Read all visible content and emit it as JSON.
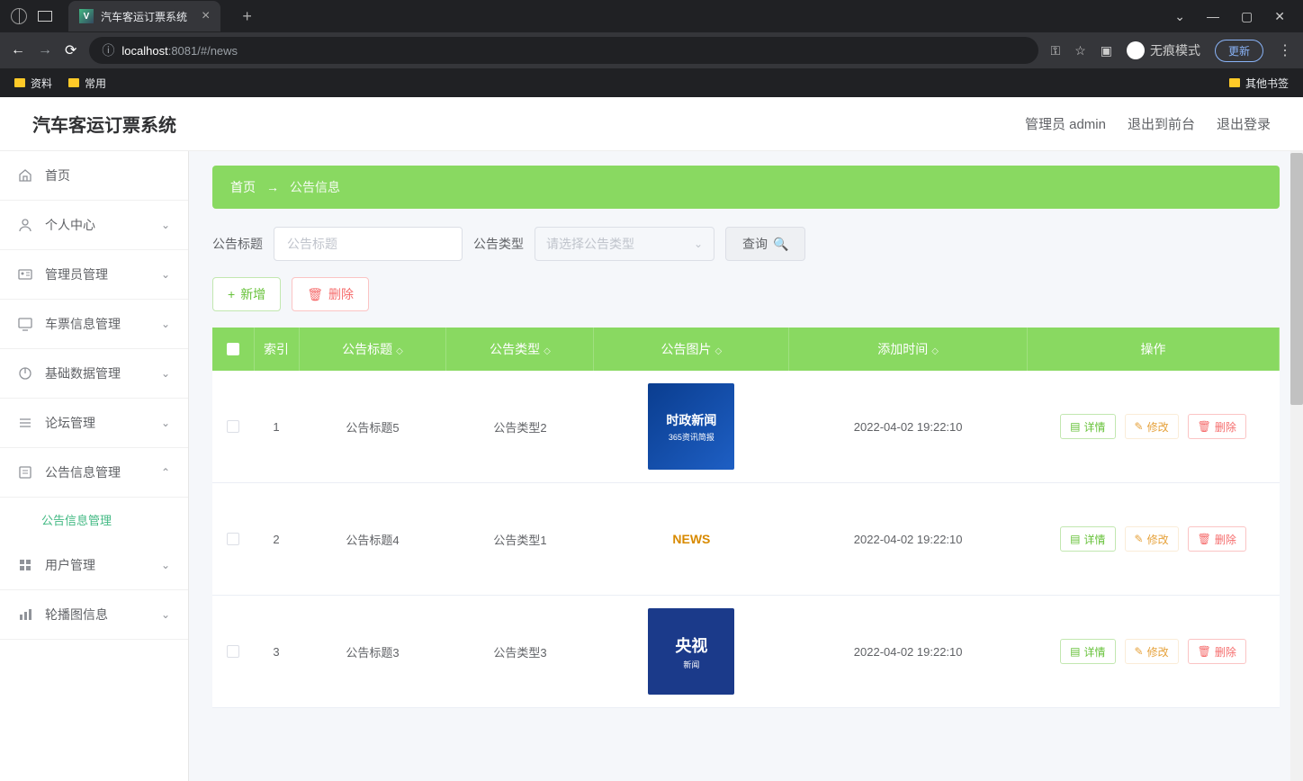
{
  "browser": {
    "tab_title": "汽车客运订票系统",
    "url_info_icon": "ⓘ",
    "url_host": "localhost",
    "url_rest": ":8081/#/news",
    "incognito_label": "无痕模式",
    "update_label": "更新"
  },
  "bookmarks": {
    "item1": "资料",
    "item2": "常用",
    "other": "其他书签"
  },
  "header": {
    "app_title": "汽车客运订票系统",
    "user_label": "管理员 admin",
    "exit_front": "退出到前台",
    "logout": "退出登录"
  },
  "sidebar": {
    "home": "首页",
    "personal": "个人中心",
    "admin_mgmt": "管理员管理",
    "ticket_mgmt": "车票信息管理",
    "base_data": "基础数据管理",
    "forum_mgmt": "论坛管理",
    "notice_mgmt": "公告信息管理",
    "notice_sub": "公告信息管理",
    "user_mgmt": "用户管理",
    "carousel": "轮播图信息"
  },
  "breadcrumb": {
    "home": "首页",
    "arrow": "→",
    "current": "公告信息"
  },
  "filters": {
    "title_label": "公告标题",
    "title_placeholder": "公告标题",
    "type_label": "公告类型",
    "type_placeholder": "请选择公告类型",
    "search_btn": "查询"
  },
  "actions": {
    "add": "新增",
    "delete": "删除"
  },
  "table": {
    "col_index": "索引",
    "col_title": "公告标题",
    "col_type": "公告类型",
    "col_img": "公告图片",
    "col_time": "添加时间",
    "col_action": "操作",
    "btn_detail": "详情",
    "btn_edit": "修改",
    "btn_delete": "删除",
    "rows": [
      {
        "idx": "1",
        "title": "公告标题5",
        "type": "公告类型2",
        "img_main": "时政新闻",
        "img_sub": "365资讯简报",
        "time": "2022-04-02 19:22:10",
        "img_style": "default"
      },
      {
        "idx": "2",
        "title": "公告标题4",
        "type": "公告类型1",
        "img_main": "NEWS",
        "img_sub": "",
        "time": "2022-04-02 19:22:10",
        "img_style": "news"
      },
      {
        "idx": "3",
        "title": "公告标题3",
        "type": "公告类型3",
        "img_main": "央视",
        "img_sub": "新闻",
        "time": "2022-04-02 19:22:10",
        "img_style": "cctv"
      }
    ]
  }
}
